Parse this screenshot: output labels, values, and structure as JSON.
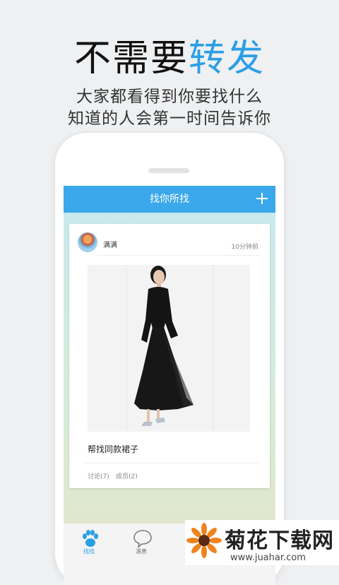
{
  "headline": {
    "part1": "不需要",
    "part2": "转发"
  },
  "subheadline": {
    "line1": "大家都看得到你要找什么",
    "line2": "知道的人会第一时间告诉你"
  },
  "app": {
    "title": "找你所找",
    "post": {
      "username": "满满",
      "time": "10分钟前",
      "caption": "帮找同款裙子",
      "discuss": "讨论(7)",
      "members": "成员(2)"
    },
    "tabs": [
      {
        "label": "找找",
        "icon": "paw-icon",
        "active": true
      },
      {
        "label": "消息",
        "icon": "chat-bubble-icon",
        "active": false
      }
    ]
  },
  "watermark": {
    "title": "菊花下载网",
    "url": "www.juahar.com"
  },
  "colors": {
    "accent": "#2c9ee6",
    "topbar": "#3aa8ea"
  }
}
